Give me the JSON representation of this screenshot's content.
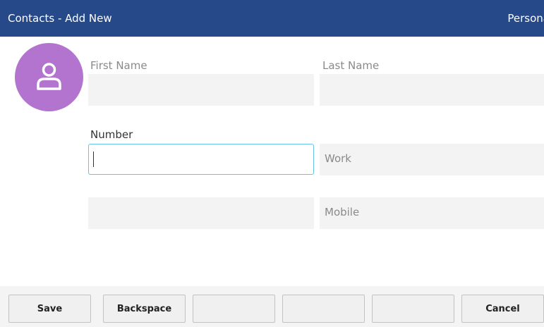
{
  "header": {
    "title": "Contacts - Add New",
    "right_label": "Persona"
  },
  "avatar": {
    "icon": "contact-person-icon",
    "color": "#b274cf"
  },
  "form": {
    "first_name_label": "First Name",
    "last_name_label": "Last Name",
    "first_name_value": "",
    "last_name_value": "",
    "number_label": "Number",
    "numbers": [
      {
        "value": "",
        "type": "Work"
      },
      {
        "value": "",
        "type": "Mobile"
      }
    ]
  },
  "softkeys": {
    "save": "Save",
    "backspace": "Backspace",
    "empty1": "",
    "empty2": "",
    "empty3": "",
    "cancel": "Cancel"
  },
  "colors": {
    "header_bg": "#26498a",
    "focus_border": "#66c3e6",
    "field_bg": "#f3f3f3"
  }
}
